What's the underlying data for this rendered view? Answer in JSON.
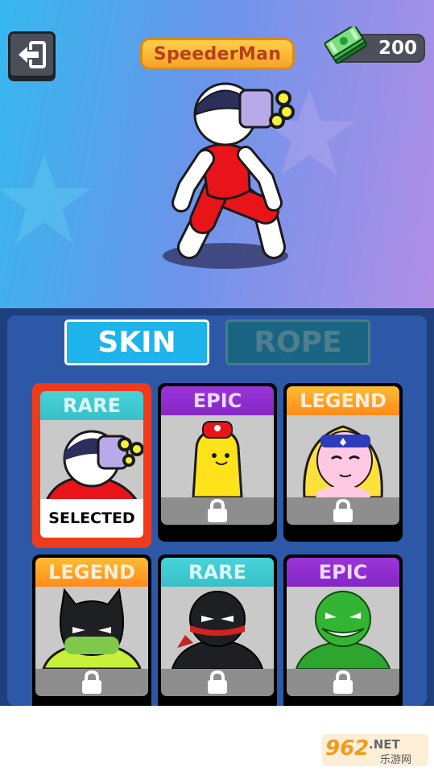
{
  "header": {
    "character_name": "SpeederMan",
    "currency_amount": "200",
    "exit_icon": "exit-door-icon",
    "currency_icon": "cash-stack-icon"
  },
  "tabs": [
    {
      "label": "SKIN",
      "active": true
    },
    {
      "label": "ROPE",
      "active": false
    }
  ],
  "skins": [
    {
      "rarity": "RARE",
      "status": "SELECTED",
      "locked": false
    },
    {
      "rarity": "EPIC",
      "locked": true
    },
    {
      "rarity": "LEGEND",
      "locked": true
    },
    {
      "rarity": "LEGEND",
      "locked": true
    },
    {
      "rarity": "RARE",
      "locked": true
    },
    {
      "rarity": "EPIC",
      "locked": true
    }
  ],
  "watermark": {
    "brand": "962",
    "suffix": ".NET",
    "subtitle": "乐游网"
  },
  "colors": {
    "rare": "#47d3d8",
    "epic": "#9a35d8",
    "legend": "#ff9f22",
    "selected_border": "#ef3b1b",
    "active_tab": "#1eb3ea"
  }
}
